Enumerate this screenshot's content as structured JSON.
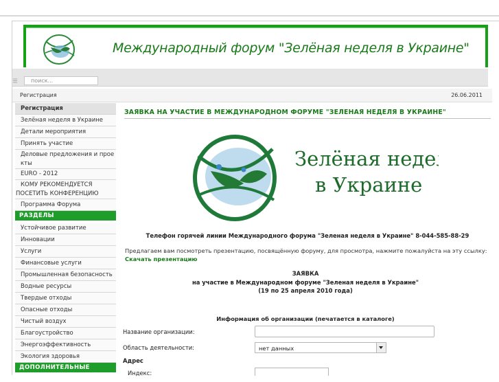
{
  "header": {
    "title": "Международный форум \"Зелёная неделя в Украине\""
  },
  "search": {
    "placeholder": "поиск..."
  },
  "breadcrumb": {
    "current": "Регистрация",
    "date": "26.06.2011"
  },
  "sidebar": {
    "items": [
      "Регистрация",
      "Зелёная неделя в Украине",
      "Детали мероприятия",
      "Принять участие",
      "Деловые предложения и проекты",
      "EURO - 2012",
      "КОМУ РЕКОМЕНДУЕТСЯ ПОСЕТИТЬ КОНФЕРЕНЦИЮ",
      "Программа Форума"
    ],
    "section_razdely": "РАЗДЕЛЫ",
    "razdely_items": [
      "Устойчивое развитие",
      "Инновации",
      "Услуги",
      "Финансовые услуги",
      "Промышленная безопасность",
      "Водные ресурсы",
      "Твердые отходы",
      "Опасные отходы",
      "Чистый воздух",
      "Благоустройство",
      "Энергоэффективность",
      "Экология здоровья"
    ],
    "section_extra": "ДОПОЛНИТЕЛЬНЫЕ УСЛУГИ"
  },
  "main": {
    "title": "ЗАЯВКА НА УЧАСТИЕ В МЕЖДУНАРОДНОМ ФОРУМЕ \"ЗЕЛЕНАЯ НЕДЕЛЯ В УКРАИНЕ\"",
    "banner_line1": "Зелёная неделя",
    "banner_line2": "в Украине",
    "hotline": "Телефон горячей линии Международного форума \"Зеленая неделя в Украине\" 8-044-585-88-29",
    "intro": "Предлагаем вам посмотреть презентацию, посвящённую форуму, для просмотра, нажмите пожалуйста на эту ссылку:",
    "download_link": "Скачать презентацию",
    "request_title": "ЗАЯВКА",
    "request_subtitle": "на участие в Международном форуме \"Зеленая неделя в Украине\"",
    "request_dates": "(19 по 25 апреля 2010 года)",
    "org_info_heading": "Информация об организации (печатается в каталоге)",
    "org_name_label": "Название организации:",
    "activity_label": "Область деятельности:",
    "activity_value": "нет данных",
    "address_label": "Адрес",
    "index_label": "Индекс:"
  },
  "colors": {
    "brand_green": "#1f9d2b",
    "title_green": "#1a7a1a"
  }
}
